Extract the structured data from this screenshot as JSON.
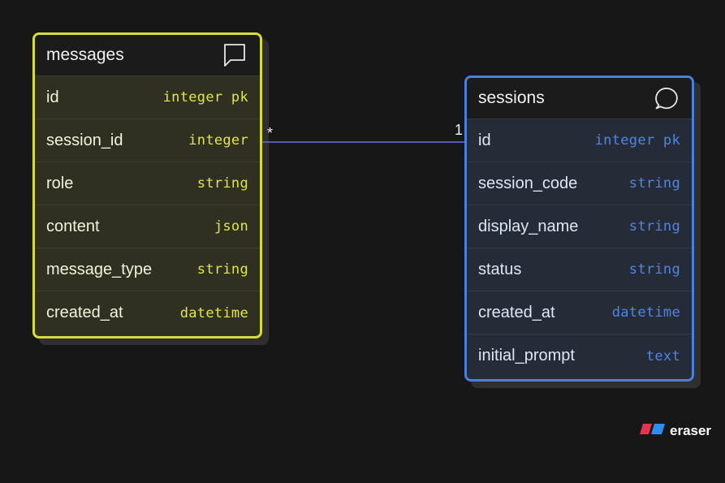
{
  "tables": {
    "messages": {
      "title": "messages",
      "icon": "comment-square-icon",
      "color": "#d6dc3a",
      "fields": [
        {
          "name": "id",
          "type": "integer pk"
        },
        {
          "name": "session_id",
          "type": "integer"
        },
        {
          "name": "role",
          "type": "string"
        },
        {
          "name": "content",
          "type": "json"
        },
        {
          "name": "message_type",
          "type": "string"
        },
        {
          "name": "created_at",
          "type": "datetime"
        }
      ]
    },
    "sessions": {
      "title": "sessions",
      "icon": "comment-bubble-icon",
      "color": "#4a7fdb",
      "fields": [
        {
          "name": "id",
          "type": "integer pk"
        },
        {
          "name": "session_code",
          "type": "string"
        },
        {
          "name": "display_name",
          "type": "string"
        },
        {
          "name": "status",
          "type": "string"
        },
        {
          "name": "created_at",
          "type": "datetime"
        },
        {
          "name": "initial_prompt",
          "type": "text"
        }
      ]
    }
  },
  "relationship": {
    "from": "messages.session_id",
    "to": "sessions.id",
    "from_cardinality": "*",
    "to_cardinality": "1"
  },
  "brand": {
    "name": "eraser",
    "icon": "eraser-logo-icon"
  }
}
